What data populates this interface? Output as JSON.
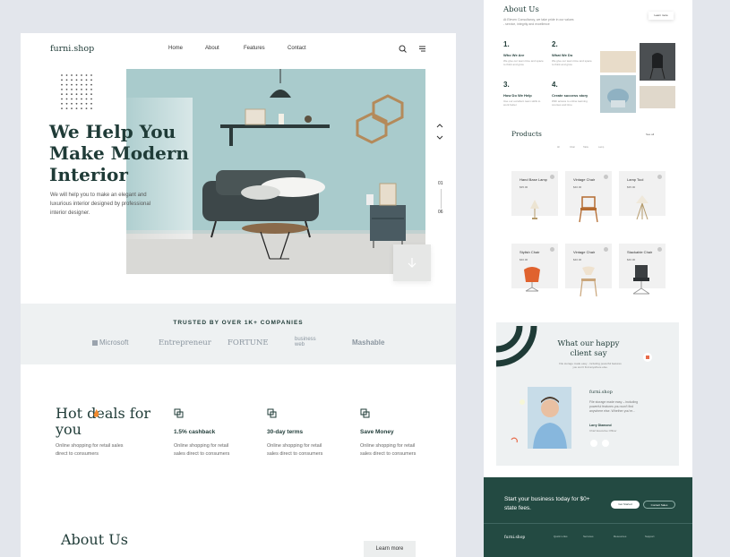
{
  "left": {
    "brand": "furni.shop",
    "nav": [
      "Home",
      "About",
      "Features",
      "Contact"
    ],
    "hero": {
      "title": "We Help You Make Modern Interior",
      "subtitle": "We will help you to make an elegant and luxurious interior designed by professional interior designer.",
      "slide_current": "01",
      "slide_total": "06"
    },
    "trusted": {
      "title": "TRUSTED BY OVER 1K+ COMPANIES",
      "logos": [
        "Microsoft",
        "Entrepreneur",
        "FORTUNE",
        "business web",
        "Mashable"
      ]
    },
    "deals": {
      "title": "Hot deals for you",
      "subtitle": "Online shopping for retail sales direct to consumers",
      "items": [
        {
          "title": "1.5% cashback",
          "text": "Online shopping for retail sales direct to consumers"
        },
        {
          "title": "30-day terms",
          "text": "Online shopping for retail sales direct to consumers"
        },
        {
          "title": "Save Money",
          "text": "Online shopping for retail sales direct to consumers"
        }
      ]
    },
    "about": {
      "title": "About Us",
      "button": "Learn more"
    }
  },
  "right": {
    "about": {
      "title": "About Us",
      "text": "At Eleven Consultancy, we take pride in our values - service, integrity and excellence",
      "button": "Learn more",
      "steps": [
        {
          "num": "1.",
          "title": "Who We Are",
          "text": "We give our team time and space to think and grow"
        },
        {
          "num": "2.",
          "title": "What We Do",
          "text": "We give our team time and space to think and grow"
        },
        {
          "num": "3.",
          "title": "How Do We Help",
          "text": "Use our excellent team skills to work better"
        },
        {
          "num": "4.",
          "title": "Create success story",
          "text": "With access to online learning courses and time"
        }
      ]
    },
    "products": {
      "title": "Products",
      "pager": "See all",
      "filters": [
        "All",
        "Chair",
        "Table",
        "Lamp"
      ],
      "items": [
        {
          "name": "Hand Base Lamp",
          "price": "$35.00"
        },
        {
          "name": "Vintage Chair",
          "price": "$40.00"
        },
        {
          "name": "Lamp Tool",
          "price": "$35.00"
        },
        {
          "name": "Stylish Chair",
          "price": "$40.00"
        },
        {
          "name": "Vintage Chair",
          "price": "$40.00"
        },
        {
          "name": "Stackable Chair",
          "price": "$40.00"
        }
      ]
    },
    "testimonial": {
      "title": "What our happy client say",
      "subtitle": "File storage made easy - including powerful features you won't find anywhere else.",
      "brand": "furni.shop",
      "quote": "File storage made easy – including powerful features you won't find anywhere else. Whether you're...",
      "name": "Larry Diamond",
      "role": "Chief Executive Officer"
    },
    "cta": {
      "text": "Start your business today for $0+ state fees.",
      "primary": "Get Started",
      "secondary": "Contact Sales"
    },
    "footer": {
      "brand": "furni.shop",
      "cols": [
        "Quick Links",
        "Services",
        "Resources",
        "Support"
      ]
    }
  },
  "colors": {
    "primary": "#1f3b37",
    "accent_bg": "#eef1f2",
    "wall": "#a8cacb"
  }
}
